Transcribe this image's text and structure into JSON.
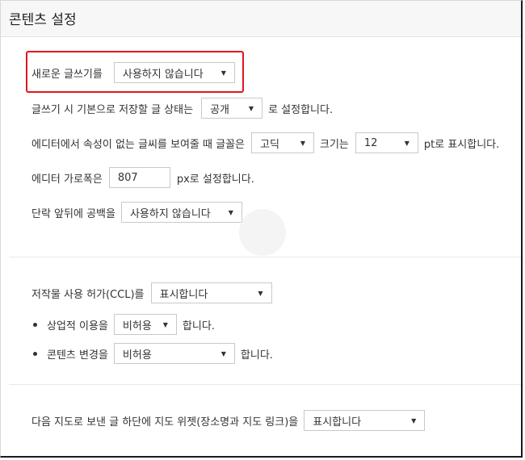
{
  "page": {
    "title": "콘텐츠 설정"
  },
  "new_editor": {
    "label": "새로운 글쓰기를",
    "value": "사용하지 않습니다"
  },
  "default_status": {
    "prefix": "글쓰기 시 기본으로 저장할 글 상태는",
    "value": "공개",
    "suffix": "로 설정합니다."
  },
  "font": {
    "prefix": "에디터에서 속성이 없는 글씨를 보여줄 때 글꼴은",
    "family_value": "고딕",
    "size_label": "크기는",
    "size_value": "12",
    "suffix": "pt로 표시합니다."
  },
  "editor_width": {
    "prefix": "에디터 가로폭은",
    "value": "807",
    "suffix": "px로 설정합니다."
  },
  "paragraph_spacing": {
    "label": "단락 앞뒤에 공백을",
    "value": "사용하지 않습니다"
  },
  "ccl": {
    "label": "저작물 사용 허가(CCL)를",
    "value": "표시합니다"
  },
  "commercial_use": {
    "label": "상업적 이용을",
    "value": "비허용",
    "suffix": "합니다."
  },
  "content_change": {
    "label": "콘텐츠 변경을",
    "value": "비허용",
    "suffix": "합니다."
  },
  "map_widget": {
    "label": "다음 지도로 보낸 글 하단에 지도 위젯(장소명과 지도 링크)을",
    "value": "표시합니다"
  },
  "colors": {
    "highlight": "#e0161e",
    "border": "#c9c9c9",
    "text": "#333333"
  },
  "icons": {
    "caret": "caret-down-icon",
    "bullet": "bullet-icon"
  }
}
